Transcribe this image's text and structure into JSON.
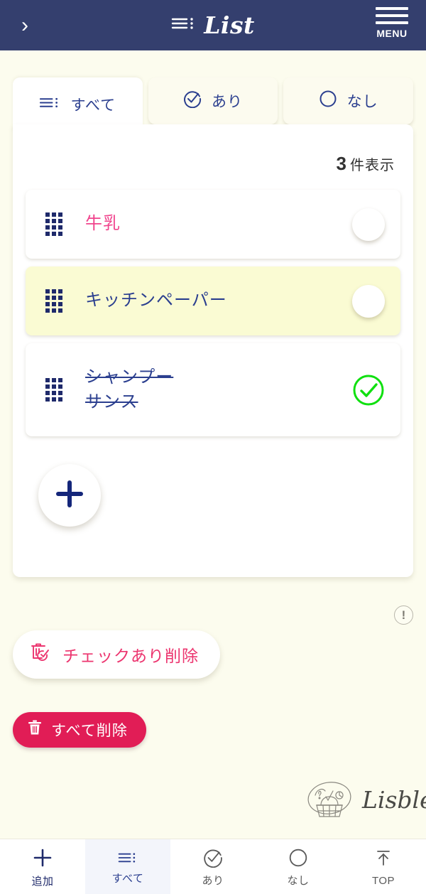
{
  "header": {
    "back_icon": "chevron-right-icon",
    "list_icon": "list-lines-icon",
    "title": "List",
    "menu_icon": "hamburger-menu-icon",
    "menu_label": "MENU",
    "bg_color": "#343f6e"
  },
  "tabs": [
    {
      "label": "すべて",
      "icon": "list-lines-icon",
      "active": true
    },
    {
      "label": "あり",
      "icon": "circle-check-icon",
      "active": false
    },
    {
      "label": "なし",
      "icon": "circle-outline-icon",
      "active": false
    }
  ],
  "panel": {
    "count_number": "3",
    "count_suffix": "件表示"
  },
  "list_items": [
    {
      "label": "牛乳",
      "checked": false,
      "color": "#f0438c",
      "highlighted": false,
      "struck": false,
      "drag_icon": "drag-handle-icon",
      "check_icon": "empty-circle-icon"
    },
    {
      "label": "キッチンペーパー",
      "checked": false,
      "color": "#2b3f8f",
      "highlighted": true,
      "struck": false,
      "drag_icon": "drag-handle-icon",
      "check_icon": "empty-circle-icon"
    },
    {
      "label": "シャンプー\nサンス",
      "checked": true,
      "color": "#2b3f8f",
      "highlighted": false,
      "struck": true,
      "drag_icon": "drag-handle-icon",
      "check_icon": "green-check-circle-icon"
    }
  ],
  "fab": {
    "icon": "plus-icon",
    "color": "#14267a"
  },
  "actions": {
    "info_icon": "exclamation-circle-icon",
    "info_glyph": "!",
    "delete_checked_label": "チェックあり削除",
    "delete_checked_icon": "trash-check-icon",
    "delete_checked_color": "#ec356f",
    "delete_all_label": "すべて削除",
    "delete_all_icon": "trash-icon",
    "delete_all_color": "#e11d56"
  },
  "brand": {
    "name": "Lisble",
    "logo_icon": "shopping-basket-sketch-icon"
  },
  "bottom_nav": [
    {
      "label": "追加",
      "icon": "plus-icon",
      "active": false,
      "accent": true
    },
    {
      "label": "すべて",
      "icon": "list-lines-icon",
      "active": true,
      "accent": false
    },
    {
      "label": "あり",
      "icon": "circle-check-icon",
      "active": false,
      "accent": false
    },
    {
      "label": "なし",
      "icon": "circle-outline-icon",
      "active": false,
      "accent": false
    },
    {
      "label": "TOP",
      "icon": "arrow-up-bar-icon",
      "active": false,
      "accent": false
    }
  ]
}
